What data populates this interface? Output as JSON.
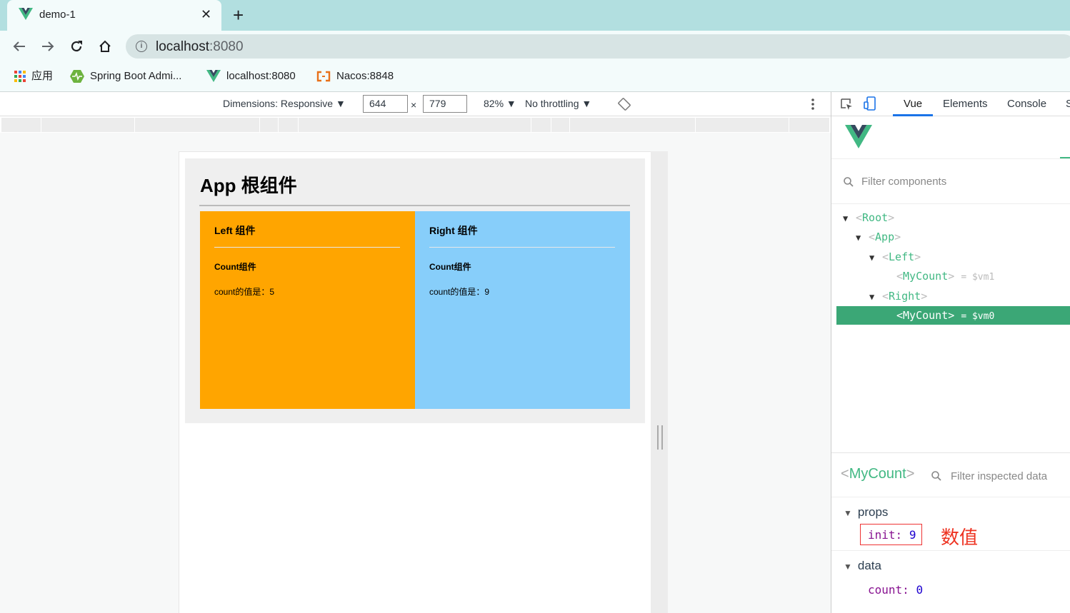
{
  "browser": {
    "tab": {
      "title": "demo-1",
      "close": "✕"
    },
    "new_tab": "+",
    "url_host": "localhost",
    "url_port": ":8080",
    "bookmarks": [
      {
        "label": "应用",
        "icon": "apps-grid-icon"
      },
      {
        "label": "Spring Boot Admi...",
        "icon": "spring-boot-admin-icon"
      },
      {
        "label": "localhost:8080",
        "icon": "vue-logo-icon"
      },
      {
        "label": "Nacos:8848",
        "icon": "nacos-icon"
      }
    ]
  },
  "device_toolbar": {
    "dimensions": "Dimensions: Responsive ▼",
    "width": "644",
    "times": "×",
    "height": "779",
    "zoom": "82% ▼",
    "throttling": "No throttling ▼"
  },
  "app": {
    "title": "App 根组件",
    "left": {
      "title": "Left 组件",
      "count_title": "Count组件",
      "count_text": "count的值是：5"
    },
    "right": {
      "title": "Right 组件",
      "count_title": "Count组件",
      "count_text": "count的值是：9"
    },
    "colors": {
      "left_bg": "#ffa500",
      "right_bg": "#87cefa"
    }
  },
  "devtools": {
    "tabs": [
      "Vue",
      "Elements",
      "Console",
      "S"
    ],
    "active_tab": "Vue",
    "filter_placeholder": "Filter components",
    "tree": [
      {
        "name": "Root",
        "open": true
      },
      {
        "name": "App",
        "open": true
      },
      {
        "name": "Left",
        "open": true
      },
      {
        "name": "MyCount",
        "ref": "= $vm1"
      },
      {
        "name": "Right",
        "open": true
      },
      {
        "name": "MyCount",
        "ref": "= $vm0",
        "selected": true
      }
    ],
    "inspector": {
      "component": "MyCount",
      "filter_placeholder": "Filter inspected data",
      "props_label": "props",
      "props": {
        "key": "init:",
        "value": "9"
      },
      "annotation": "数值",
      "data_label": "data",
      "data": {
        "key": "count:",
        "value": "0"
      }
    },
    "accent": "#41b883"
  }
}
